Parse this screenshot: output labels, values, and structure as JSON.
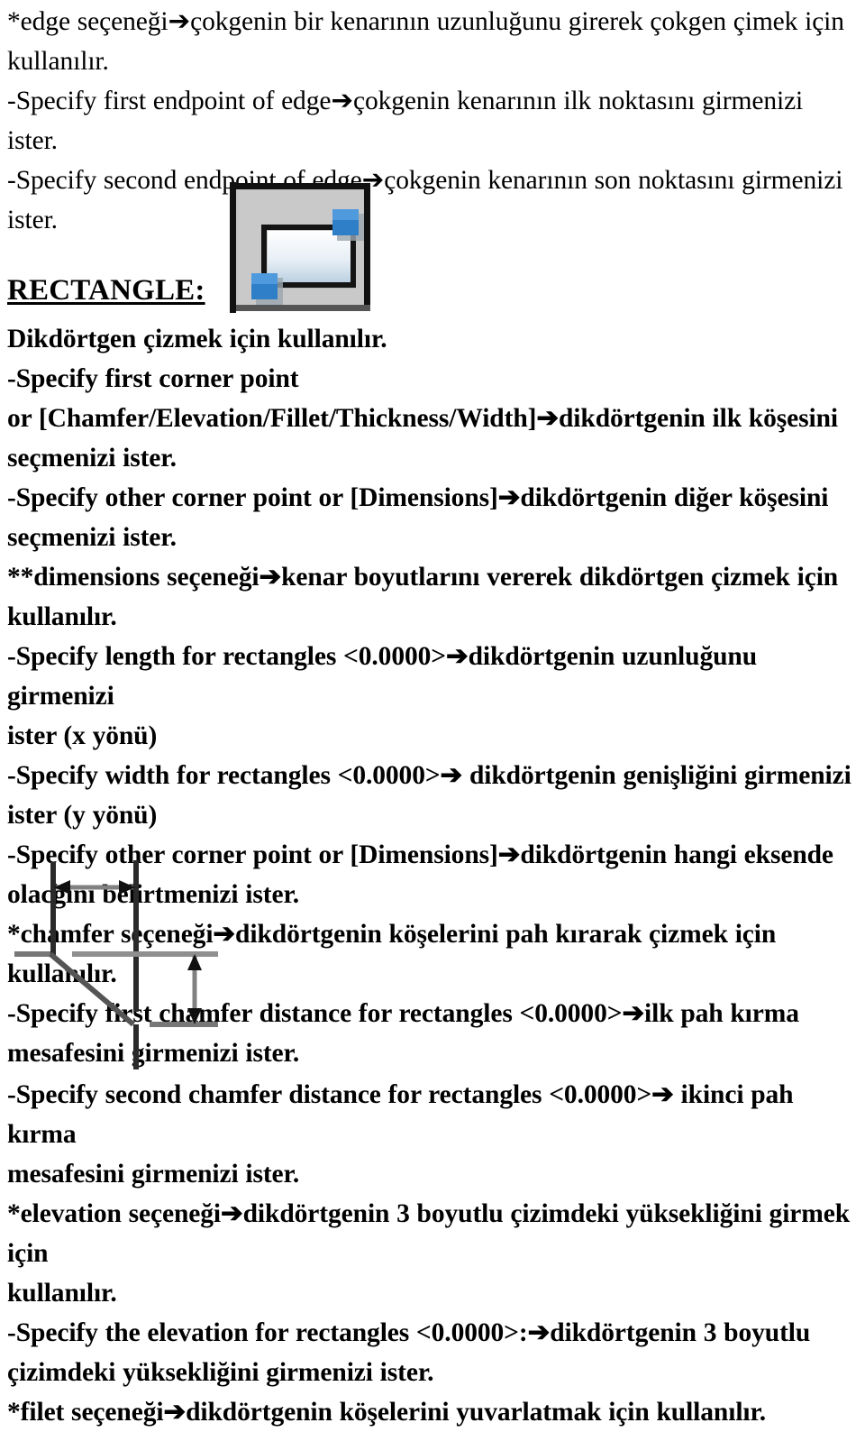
{
  "document": {
    "language": "tr",
    "text_color": "#000000",
    "background_color": "#ffffff"
  },
  "top_block": {
    "lines": [
      "*edge seçeneği➔çokgenin bir kenarının uzunluğunu girerek çokgen çimek için",
      "kullanılır.",
      "-Specify first endpoint of edge➔çokgenin kenarının ilk noktasını girmenizi",
      "ister.",
      "-Specify second endpoint of edge➔çokgenin kenarının son noktasını girmenizi",
      "ister."
    ],
    "paragraph_text": "*edge seçeneği➔çokgenin bir kenarının uzunluğunu girerek çokgen çimek için\nkullanılır.\n-Specify first endpoint of edge➔çokgenin kenarının ilk noktasını girmenizi\nister.\n-Specify second endpoint of edge➔çokgenin kenarının son noktasını girmenizi\nister."
  },
  "heading": {
    "label": "RECTANGLE:",
    "style": "bold-underline"
  },
  "rect_icon": {
    "name": "rectangle-tool-icon",
    "frame_color": "#1a1a1a",
    "background_color": "#c0c0c0",
    "outline_color": "#1a1a1a",
    "fill_top_color": "#ffffff",
    "fill_bottom_color": "#b9cfe0",
    "handle_color": "#2f7ec8",
    "handle_shadow_color": "#9aa6ae"
  },
  "mid_block": {
    "paragraph_text": "Dikdörtgen çizmek için kullanılır.\n-Specify first corner point\nor [Chamfer/Elevation/Fillet/Thickness/Width]➔dikdörtgenin ilk köşesini\nseçmenizi ister.\n-Specify other corner point or [Dimensions]➔dikdörtgenin diğer köşesini\nseçmenizi ister.\n**dimensions seçeneği➔kenar boyutlarını vererek dikdörtgen çizmek için\nkullanılır.\n-Specify length for rectangles <0.0000>➔dikdörtgenin uzunluğunu girmenizi\nister (x yönü)\n-Specify width for rectangles <0.0000>➔ dikdörtgenin genişliğini girmenizi\nister (y yönü)\n-Specify other corner point or [Dimensions]➔dikdörtgenin hangi eksende\nolacğını belirtmenizi ister.\n*chamfer seçeneği➔dikdörtgenin köşelerini pah kırarak çizmek için kullanılır.\n-Specify first chamfer distance for rectangles <0.0000>➔ilk pah kırma\nmesafesini girmenizi ister.",
    "lines": [
      "Dikdörtgen çizmek için kullanılır.",
      "-Specify first corner point",
      "or [Chamfer/Elevation/Fillet/Thickness/Width]➔dikdörtgenin ilk köşesini",
      "seçmenizi ister.",
      "-Specify other corner point or [Dimensions]➔dikdörtgenin diğer köşesini",
      "seçmenizi ister.",
      "**dimensions seçeneği➔kenar boyutlarını vererek dikdörtgen çizmek için",
      "kullanılır.",
      "-Specify length for rectangles <0.0000>➔dikdörtgenin uzunluğunu girmenizi",
      "ister (x yönü)",
      "-Specify width for rectangles <0.0000>➔ dikdörtgenin genişliğini girmenizi",
      "ister (y yönü)",
      "-Specify other corner point or [Dimensions]➔dikdörtgenin hangi eksende",
      "olacğını belirtmenizi ister.",
      "*chamfer seçeneği➔dikdörtgenin köşelerini pah kırarak çizmek için kullanılır.",
      "-Specify first chamfer distance for rectangles <0.0000>➔ilk pah kırma",
      "mesafesini girmenizi ister."
    ]
  },
  "chamfer_diagram": {
    "name": "chamfer-dimension-diagram",
    "description": "Technical drawing showing a chamfered corner with horizontal and vertical dimension arrows",
    "line_color": "#3a3a3a",
    "stroke_color_dark": "#1a1a1a"
  },
  "bottom_block": {
    "paragraph_text": "-Specify second chamfer distance for rectangles <0.0000>➔ ikinci pah kırma\nmesafesini girmenizi ister.\n*elevation seçeneği➔dikdörtgenin 3 boyutlu çizimdeki yüksekliğini girmek için\nkullanılır.\n-Specify the elevation for rectangles <0.0000>:➔dikdörtgenin 3 boyutlu\nçizimdeki yüksekliğini girmenizi ister.\n*filet seçeneği➔dikdörtgenin köşelerini yuvarlatmak için kullanılır.",
    "lines": [
      "-Specify second chamfer distance for rectangles <0.0000>➔ ikinci pah kırma",
      "mesafesini girmenizi ister.",
      "*elevation seçeneği➔dikdörtgenin 3 boyutlu çizimdeki yüksekliğini girmek için",
      "kullanılır.",
      "-Specify the elevation for rectangles <0.0000>:➔dikdörtgenin 3 boyutlu",
      "çizimdeki yüksekliğini girmenizi ister.",
      "*filet seçeneği➔dikdörtgenin köşelerini yuvarlatmak için kullanılır."
    ]
  }
}
